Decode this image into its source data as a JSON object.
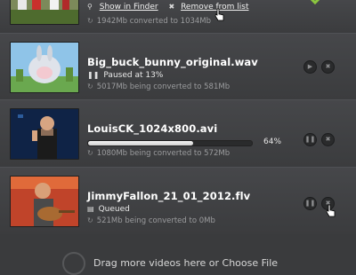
{
  "window": {
    "title": ""
  },
  "rows": [
    {
      "state": "done",
      "show_in_finder": "Show in Finder",
      "remove_from_list": "Remove from list",
      "info": "1942Mb converted to 1034Mb"
    },
    {
      "state": "paused",
      "title": "Big_buck_bunny_original.wav",
      "status": "Paused at 13%",
      "progress": 0.13,
      "info": "5017Mb being converted to 581Mb",
      "controls": [
        "play-icon",
        "stop-icon"
      ]
    },
    {
      "state": "converting",
      "title": "LouisCK_1024x800.avi",
      "percent_label": "64%",
      "progress": 0.64,
      "info": "1080Mb being converted to 572Mb",
      "controls": [
        "pause-icon",
        "stop-icon"
      ]
    },
    {
      "state": "queued",
      "title": "JimmyFallon_21_01_2012.flv",
      "status": "Queued",
      "info": "521Mb being converted to 0Mb",
      "controls": [
        "pause-icon",
        "stop-icon"
      ]
    }
  ],
  "footer": {
    "drop_text": "Drag more videos here or Choose File"
  },
  "colors": {
    "success": "#8cc63f",
    "background": "#3a3b3d"
  }
}
